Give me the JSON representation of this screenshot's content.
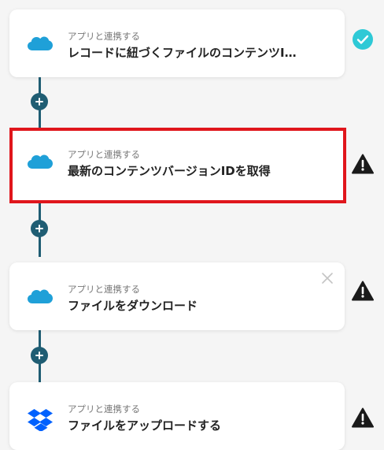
{
  "flow": {
    "steps": [
      {
        "subtitle": "アプリと連携する",
        "title": "レコードに紐づくファイルのコンテンツI…",
        "icon": "salesforce-cloud-icon",
        "status": "check-circle-icon"
      },
      {
        "subtitle": "アプリと連携する",
        "title": "最新のコンテンツバージョンIDを取得",
        "icon": "salesforce-cloud-icon",
        "status": "warning-icon"
      },
      {
        "subtitle": "アプリと連携する",
        "title": "ファイルをダウンロード",
        "icon": "salesforce-cloud-icon",
        "status": "warning-icon"
      },
      {
        "subtitle": "アプリと連携する",
        "title": "ファイルをアップロードする",
        "icon": "dropbox-icon",
        "status": "warning-icon"
      }
    ]
  },
  "colors": {
    "connector": "#1f5d73",
    "salesforce": "#1fa0d8",
    "dropbox": "#0061fe",
    "check": "#2ec9d6",
    "selection": "#e0161c",
    "warning": "#1a1a1a"
  }
}
